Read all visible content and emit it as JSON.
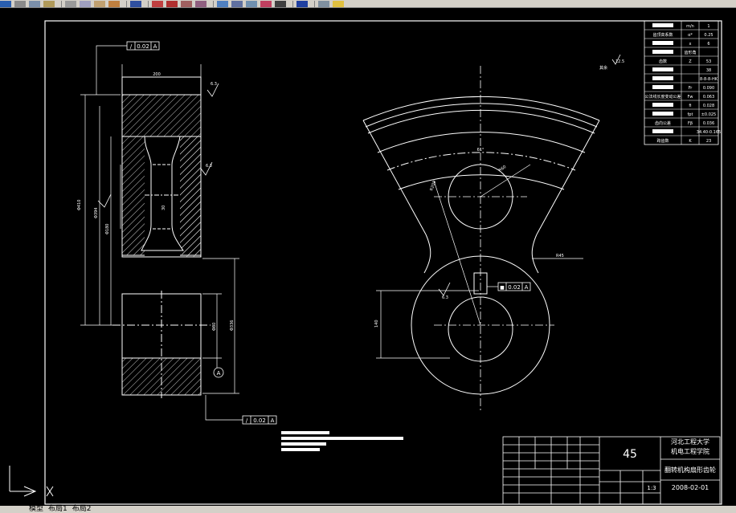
{
  "toolbar": {
    "icons": [
      "save-icon",
      "print-icon",
      "preview-icon",
      "publish-icon",
      "cut-icon",
      "zoom-realtime-icon",
      "zoom-window-icon",
      "zoom-previous-icon",
      "pan-icon",
      "properties-icon",
      "designcenter-icon",
      "tool-palettes-icon",
      "markup-icon",
      "calculator-icon",
      "layer-icon",
      "help-icon"
    ]
  },
  "tabs": {
    "model": "模型",
    "layout1": "布局1",
    "layout2": "布局2"
  },
  "drawing": {
    "tolerance_top": {
      "symbol": "/",
      "value": "0.02",
      "datum": "A"
    },
    "tolerance_bottom": {
      "symbol": "/",
      "value": "0.02",
      "datum": "A"
    },
    "tolerance_front": {
      "symbol": "■",
      "value": "0.02",
      "datum": "A"
    },
    "datum_a": "A",
    "dim_width": "200",
    "dim_d1": "Φ410",
    "dim_d2": "Φ394",
    "dim_d3": "Φ180",
    "dim_hub": "Φ80",
    "dim_b1": "Φ336",
    "dim_key": "30",
    "dim_r45": "R45",
    "dim_front_h": "140",
    "dim_angle": "61°",
    "roughness_top": "6.3",
    "roughness_mid": "6.3",
    "roughness_front": "6.3",
    "roughness_other": "其余",
    "roughness_other_val": "12.5",
    "dim_r60": "R60",
    "dim_r208": "R208"
  },
  "param_table": {
    "rows": [
      [
        "",
        "m/n",
        "1"
      ],
      [
        "齿顶高系数",
        "α*",
        "0.25"
      ],
      [
        "",
        "x",
        "6"
      ],
      [
        "",
        "齿形角",
        ""
      ],
      [
        "齿数",
        "Z",
        "53"
      ],
      [
        "",
        "",
        "38"
      ],
      [
        "",
        "",
        "8-8-8-HK"
      ],
      [
        "",
        "Fr",
        "0.090"
      ],
      [
        "公法线长度变动公差",
        "Fw",
        "0.063"
      ],
      [
        "",
        "fi",
        "0.028"
      ],
      [
        "",
        "fpt",
        "±0.025"
      ],
      [
        "齿向公差",
        "Fβ",
        "0.036"
      ],
      [
        "",
        "",
        "34.40-0.165"
      ],
      [
        "跨齿数",
        "K",
        "23"
      ]
    ]
  },
  "title_block": {
    "material": "45",
    "school_line1": "河北工程大学",
    "school_line2": "机电工程学院",
    "part_name": "翻转机构扇形齿轮",
    "scale": "1:3",
    "date": "2008-02-01"
  },
  "notes": [
    "技术要求",
    "",
    ""
  ]
}
